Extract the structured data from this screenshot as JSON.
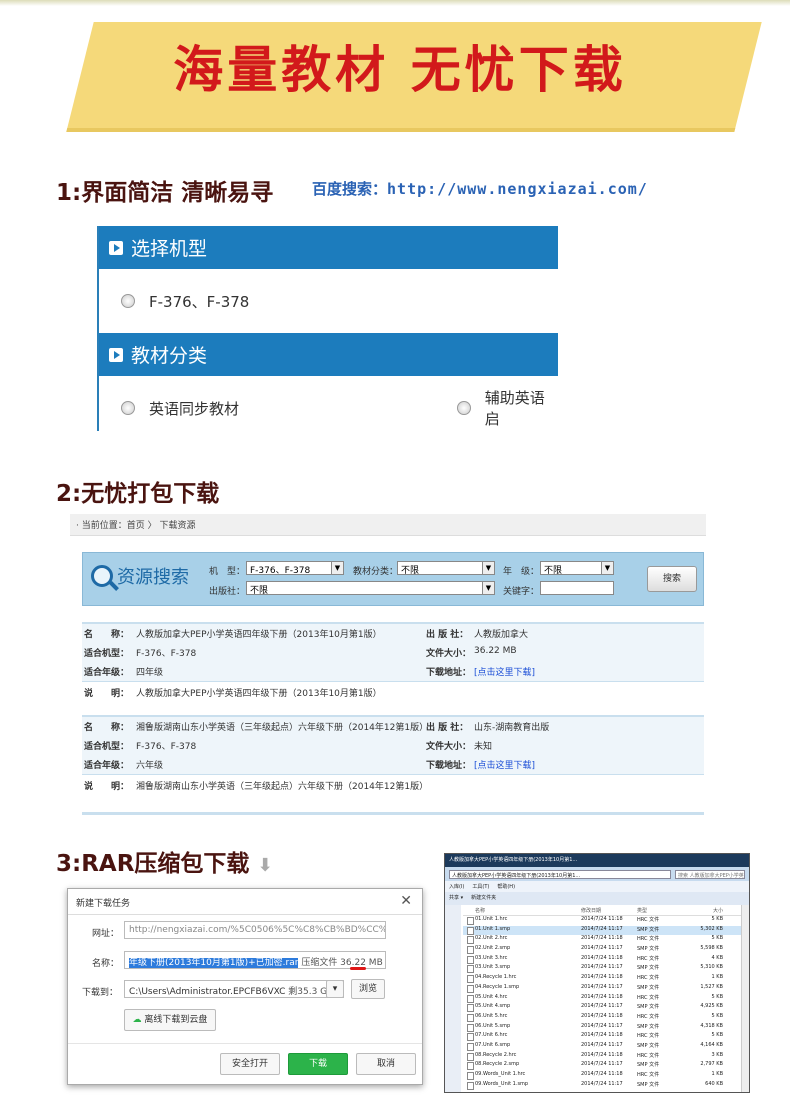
{
  "banner": {
    "title": "海量教材 无忧下载"
  },
  "step1": {
    "title": "1:界面简洁 清晰易寻",
    "hint_label": "百度搜索：",
    "hint_url": "http://www.nengxiazai.com/"
  },
  "panel1": {
    "section1_title": "选择机型",
    "model_option": "F-376、F-378",
    "section2_title": "教材分类",
    "category_option1": "英语同步教材",
    "category_option2": "辅助英语启"
  },
  "step2": {
    "title": "2:无忧打包下载"
  },
  "panel2": {
    "breadcrumb": "· 当前位置：首页 〉 下载资源",
    "search_logo": "资源搜索",
    "model_label": "机　型：",
    "model_value": "F-376、F-378",
    "category_label": "教材分类：",
    "category_value": "不限",
    "grade_label": "年　级：",
    "grade_value": "不限",
    "publisher_label": "出版社：",
    "publisher_value": "不限",
    "keyword_label": "关键字：",
    "search_button": "搜索",
    "records": [
      {
        "name_key": "名　　称：",
        "name": "人教版加拿大PEP小学英语四年级下册（2013年10月第1版）",
        "pub_key": "出 版 社：",
        "pub": "人教版加拿大",
        "model_key": "适合机型：",
        "model": "F-376、F-378",
        "size_key": "文件大小：",
        "size": "36.22 MB",
        "grade_key": "适合年级：",
        "grade": "四年级",
        "dl_key": "下载地址：",
        "dl": "[点击这里下载]",
        "desc_key": "说　　明：",
        "desc": "人教版加拿大PEP小学英语四年级下册（2013年10月第1版）"
      },
      {
        "name_key": "名　　称：",
        "name": "湘鲁版湖南山东小学英语（三年级起点）六年级下册（2014年12第1版）",
        "pub_key": "出 版 社：",
        "pub": "山东-湖南教育出版",
        "model_key": "适合机型：",
        "model": "F-376、F-378",
        "size_key": "文件大小：",
        "size": "未知",
        "grade_key": "适合年级：",
        "grade": "六年级",
        "dl_key": "下载地址：",
        "dl": "[点击这里下载]",
        "desc_key": "说　　明：",
        "desc": "湘鲁版湖南山东小学英语（三年级起点）六年级下册（2014年12第1版）"
      }
    ]
  },
  "step3": {
    "title": "3:RAR压缩包下载",
    "arrow": "⬇"
  },
  "dialog": {
    "title": "新建下载任务",
    "url_label": "网址：",
    "url_value": "http://nengxiazai.com/%5C0506%5C%C8%CB%BD%CC%B",
    "name_label": "名称：",
    "name_value": "年级下册(2013年10月第1版)+已加密.rar",
    "file_type": "压缩文件 36.22 MB",
    "save_label": "下载到：",
    "save_value": "C:\\Users\\Administrator.EPCFB6VXC",
    "free_space": "剩35.3 GB",
    "browse": "浏览",
    "cloud": "离线下载到云盘",
    "safe_open": "安全打开",
    "download": "下载",
    "cancel": "取消"
  },
  "explorer": {
    "title": "人教版加拿大PEP小学英语四年级下册(2013年10月第1...",
    "address": "人教版加拿大PEP小学英语四年级下册(2013年10月第1...",
    "search": "搜索 人教版加拿大PEP小学英语四年...",
    "menu": [
      "工具(T)",
      "帮助(H)"
    ],
    "menu_prefix": "入库(I)",
    "toolbar": [
      "共享 ▾",
      "新建文件夹"
    ],
    "headers": [
      "名称",
      "修改日期",
      "类型",
      "大小"
    ],
    "rows": [
      [
        "01.Unit 1.hrc",
        "2014/7/24 11:18",
        "HRC 文件",
        "5 KB"
      ],
      [
        "01.Unit 1.smp",
        "2014/7/24 11:17",
        "SMP 文件",
        "5,302 KB"
      ],
      [
        "02.Unit 2.hrc",
        "2014/7/24 11:18",
        "HRC 文件",
        "5 KB"
      ],
      [
        "02.Unit 2.smp",
        "2014/7/24 11:17",
        "SMP 文件",
        "5,598 KB"
      ],
      [
        "03.Unit 3.hrc",
        "2014/7/24 11:18",
        "HRC 文件",
        "4 KB"
      ],
      [
        "03.Unit 3.smp",
        "2014/7/24 11:17",
        "SMP 文件",
        "5,310 KB"
      ],
      [
        "04.Recycle 1.hrc",
        "2014/7/24 11:18",
        "HRC 文件",
        "1 KB"
      ],
      [
        "04.Recycle 1.smp",
        "2014/7/24 11:17",
        "SMP 文件",
        "1,527 KB"
      ],
      [
        "05.Unit 4.hrc",
        "2014/7/24 11:18",
        "HRC 文件",
        "5 KB"
      ],
      [
        "05.Unit 4.smp",
        "2014/7/24 11:17",
        "SMP 文件",
        "4,925 KB"
      ],
      [
        "06.Unit 5.hrc",
        "2014/7/24 11:18",
        "HRC 文件",
        "5 KB"
      ],
      [
        "06.Unit 5.smp",
        "2014/7/24 11:17",
        "SMP 文件",
        "4,318 KB"
      ],
      [
        "07.Unit 6.hrc",
        "2014/7/24 11:18",
        "HRC 文件",
        "5 KB"
      ],
      [
        "07.Unit 6.smp",
        "2014/7/24 11:17",
        "SMP 文件",
        "4,164 KB"
      ],
      [
        "08.Recycle 2.hrc",
        "2014/7/24 11:18",
        "HRC 文件",
        "3 KB"
      ],
      [
        "08.Recycle 2.smp",
        "2014/7/24 11:17",
        "SMP 文件",
        "2,797 KB"
      ],
      [
        "09.Words_Unit 1.hrc",
        "2014/7/24 11:18",
        "HRC 文件",
        "1 KB"
      ],
      [
        "09.Words_Unit 1.smp",
        "2014/7/24 11:17",
        "SMP 文件",
        "640 KB"
      ]
    ]
  }
}
